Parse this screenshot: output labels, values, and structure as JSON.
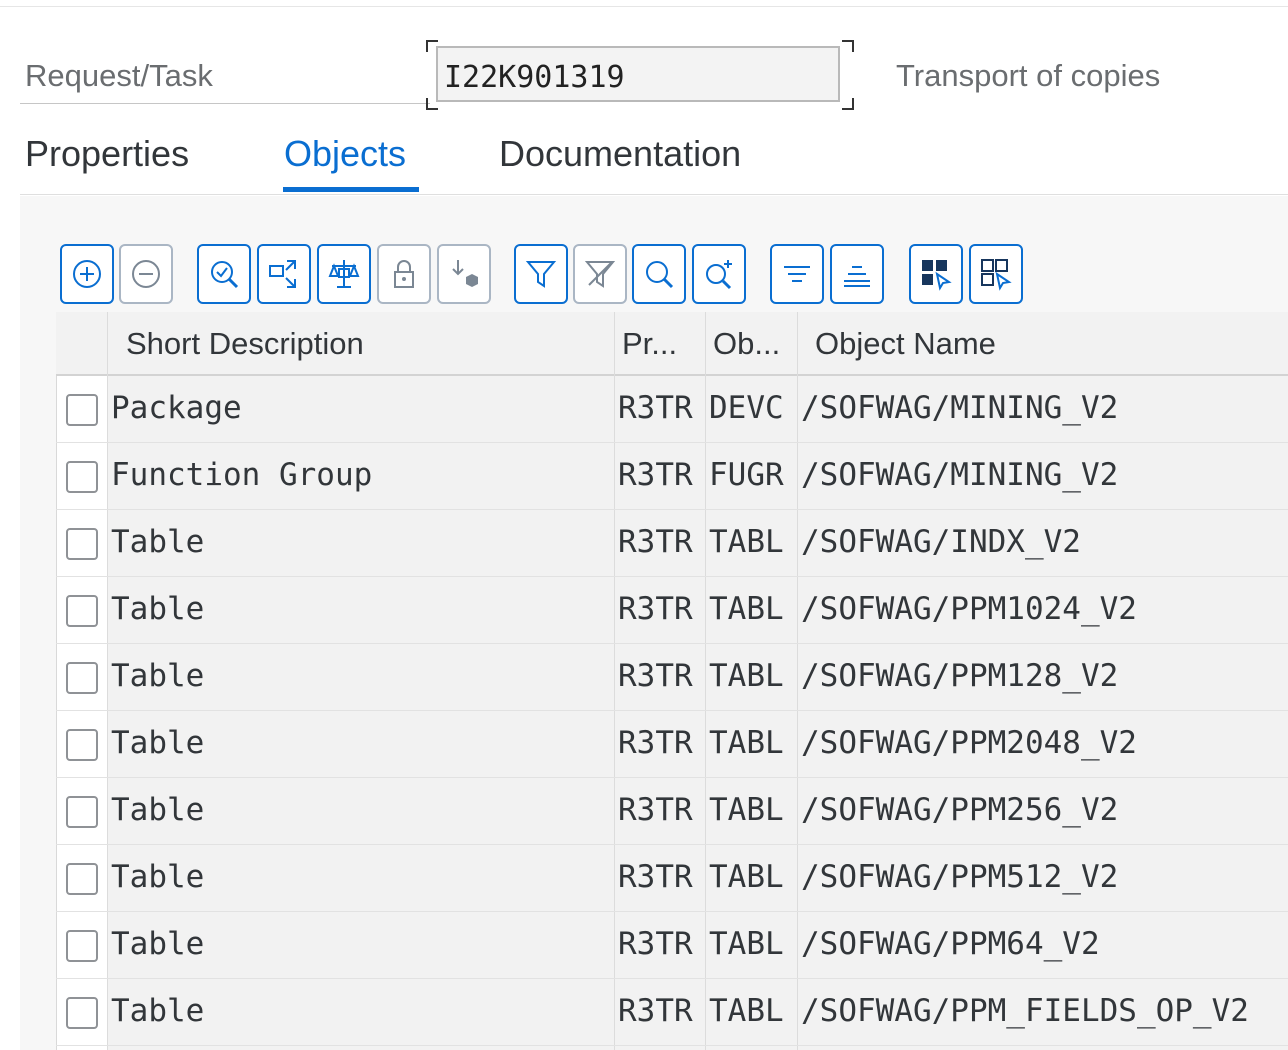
{
  "header": {
    "request_label": "Request/Task",
    "request_value": "I22K901319",
    "request_description": "Transport of copies"
  },
  "tabs": [
    {
      "label": "Properties",
      "active": false
    },
    {
      "label": "Objects",
      "active": true
    },
    {
      "label": "Documentation",
      "active": false
    }
  ],
  "toolbar": {
    "buttons": [
      {
        "icon": "add-icon"
      },
      {
        "icon": "remove-icon"
      },
      {
        "icon": "zoom-details-icon"
      },
      {
        "icon": "compare-expand-icon"
      },
      {
        "icon": "balance-scale-icon"
      },
      {
        "icon": "lock-icon"
      },
      {
        "icon": "import-object-icon"
      },
      {
        "icon": "filter-icon"
      },
      {
        "icon": "filter-clear-icon"
      },
      {
        "icon": "search-icon"
      },
      {
        "icon": "search-next-icon"
      },
      {
        "icon": "sort-ascending-icon"
      },
      {
        "icon": "sort-descending-icon"
      },
      {
        "icon": "select-all-icon"
      },
      {
        "icon": "deselect-all-icon"
      }
    ]
  },
  "table": {
    "columns": [
      "Short Description",
      "Pr...",
      "Ob...",
      "Object Name"
    ],
    "rows": [
      {
        "description": "Package",
        "pgmid": "R3TR",
        "object": "DEVC",
        "name": "/SOFWAG/MINING_V2"
      },
      {
        "description": "Function Group",
        "pgmid": "R3TR",
        "object": "FUGR",
        "name": "/SOFWAG/MINING_V2"
      },
      {
        "description": "Table",
        "pgmid": "R3TR",
        "object": "TABL",
        "name": "/SOFWAG/INDX_V2"
      },
      {
        "description": "Table",
        "pgmid": "R3TR",
        "object": "TABL",
        "name": "/SOFWAG/PPM1024_V2"
      },
      {
        "description": "Table",
        "pgmid": "R3TR",
        "object": "TABL",
        "name": "/SOFWAG/PPM128_V2"
      },
      {
        "description": "Table",
        "pgmid": "R3TR",
        "object": "TABL",
        "name": "/SOFWAG/PPM2048_V2"
      },
      {
        "description": "Table",
        "pgmid": "R3TR",
        "object": "TABL",
        "name": "/SOFWAG/PPM256_V2"
      },
      {
        "description": "Table",
        "pgmid": "R3TR",
        "object": "TABL",
        "name": "/SOFWAG/PPM512_V2"
      },
      {
        "description": "Table",
        "pgmid": "R3TR",
        "object": "TABL",
        "name": "/SOFWAG/PPM64_V2"
      },
      {
        "description": "Table",
        "pgmid": "R3TR",
        "object": "TABL",
        "name": "/SOFWAG/PPM_FIELDS_OP_V2"
      }
    ]
  },
  "colors": {
    "accent": "#0a6ed1",
    "text": "#32363a",
    "label": "#6a6d70"
  }
}
